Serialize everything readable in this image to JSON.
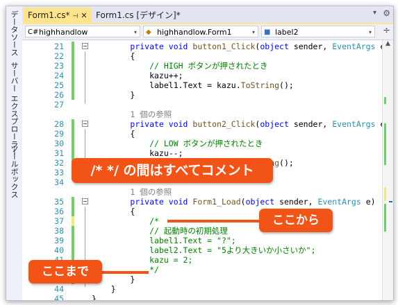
{
  "sidebar": {
    "items": [
      "データソース",
      "サーバー エクスプローラー",
      "ツールボックス"
    ]
  },
  "tabs": [
    {
      "label": "Form1.cs*",
      "pin": "⊣",
      "close": "✕"
    },
    {
      "label": "Form1.cs [デザイン]*"
    }
  ],
  "tab_menu_icon": "▾",
  "tab_settings_icon": "⚙",
  "navbar": {
    "project": "highhandlow",
    "class": "highhandlow.Form1",
    "member": "label2",
    "dropdown_icon": "▾",
    "split_icon": "÷"
  },
  "scroll": {
    "up_arrow": "▲"
  },
  "code_lines": [
    {
      "n": "21",
      "bar": "#6fcf6b",
      "fold": "⊟",
      "parts": [
        [
          "",
          "        "
        ],
        [
          "kw",
          "private void "
        ],
        [
          "mt",
          "button1_Click"
        ],
        [
          "",
          "("
        ],
        [
          "kw",
          "object"
        ],
        [
          "",
          " sender, "
        ],
        [
          "ty",
          "EventArgs"
        ],
        [
          "",
          " e)"
        ]
      ]
    },
    {
      "n": "22",
      "bar": "#6fcf6b",
      "parts": [
        [
          "",
          "        {"
        ]
      ]
    },
    {
      "n": "23",
      "bar": "#6fcf6b",
      "parts": [
        [
          "",
          "            "
        ],
        [
          "cm",
          "// HIGH ボタンが押されたとき"
        ]
      ]
    },
    {
      "n": "24",
      "bar": "#6fcf6b",
      "parts": [
        [
          "",
          "            kazu++;"
        ]
      ]
    },
    {
      "n": "25",
      "bar": "#6fcf6b",
      "parts": [
        [
          "",
          "            label1.Text = kazu."
        ],
        [
          "mt",
          "ToString"
        ],
        [
          "",
          "();"
        ]
      ]
    },
    {
      "n": "26",
      "bar": "#6fcf6b",
      "parts": [
        [
          "",
          "        }"
        ]
      ]
    },
    {
      "n": "27",
      "bar": "",
      "parts": [
        [
          "",
          ""
        ]
      ]
    },
    {
      "n": "",
      "bar": "",
      "parts": [
        [
          "ref",
          "        1 個の参照"
        ]
      ]
    },
    {
      "n": "28",
      "bar": "#6fcf6b",
      "fold": "⊟",
      "parts": [
        [
          "",
          "        "
        ],
        [
          "kw",
          "private void "
        ],
        [
          "mt",
          "button2_Click"
        ],
        [
          "",
          "("
        ],
        [
          "kw",
          "object"
        ],
        [
          "",
          " sender, "
        ],
        [
          "ty",
          "EventArgs"
        ],
        [
          "",
          " e)"
        ]
      ]
    },
    {
      "n": "29",
      "bar": "#6fcf6b",
      "parts": [
        [
          "",
          "        {"
        ]
      ]
    },
    {
      "n": "30",
      "bar": "#6fcf6b",
      "parts": [
        [
          "",
          "            "
        ],
        [
          "cm",
          "// LOW ボタンが押されたとき"
        ]
      ]
    },
    {
      "n": "31",
      "bar": "#6fcf6b",
      "parts": [
        [
          "",
          "            kazu--;"
        ]
      ]
    },
    {
      "n": "32",
      "bar": "#6fcf6b",
      "parts": [
        [
          "",
          "            label1.Text = kazu."
        ],
        [
          "mt",
          "ToString"
        ],
        [
          "",
          "();"
        ]
      ]
    },
    {
      "n": "33",
      "bar": "#6fcf6b",
      "parts": [
        [
          "",
          "        }"
        ]
      ]
    },
    {
      "n": "34",
      "bar": "",
      "parts": [
        [
          "",
          ""
        ]
      ]
    },
    {
      "n": "",
      "bar": "",
      "parts": [
        [
          "ref",
          "        1 個の参照"
        ]
      ]
    },
    {
      "n": "35",
      "bar": "#6fcf6b",
      "fold": "⊟",
      "parts": [
        [
          "",
          "        "
        ],
        [
          "kw",
          "private void "
        ],
        [
          "mt",
          "Form1_Load"
        ],
        [
          "",
          "("
        ],
        [
          "kw",
          "object"
        ],
        [
          "",
          " sender, "
        ],
        [
          "ty",
          "EventArgs"
        ],
        [
          "",
          " e)"
        ]
      ]
    },
    {
      "n": "36",
      "bar": "#6fcf6b",
      "parts": [
        [
          "",
          "        {"
        ]
      ]
    },
    {
      "n": "37",
      "bar": "#f2e77a",
      "parts": [
        [
          "",
          "            "
        ],
        [
          "cm",
          "/*"
        ]
      ]
    },
    {
      "n": "38",
      "bar": "#6fcf6b",
      "parts": [
        [
          "",
          "            "
        ],
        [
          "cm",
          "// 起動時の初期処理"
        ]
      ]
    },
    {
      "n": "39",
      "bar": "#6fcf6b",
      "parts": [
        [
          "",
          "            "
        ],
        [
          "cm",
          "label1.Text = \"?\";"
        ]
      ]
    },
    {
      "n": "40",
      "bar": "#6fcf6b",
      "parts": [
        [
          "",
          "            "
        ],
        [
          "cm",
          "label2.Text = \"5より大きいか小さいか\";"
        ]
      ]
    },
    {
      "n": "41",
      "bar": "#6fcf6b",
      "parts": [
        [
          "",
          "            "
        ],
        [
          "cm",
          "kazu = 2;"
        ]
      ]
    },
    {
      "n": "42",
      "bar": "#f2e77a",
      "parts": [
        [
          "",
          "            "
        ],
        [
          "cm",
          "*/"
        ]
      ]
    },
    {
      "n": "43",
      "bar": "#6fcf6b",
      "parts": [
        [
          "",
          "        }"
        ]
      ]
    },
    {
      "n": "44",
      "bar": "",
      "parts": [
        [
          "",
          "    }"
        ]
      ]
    },
    {
      "n": "45",
      "bar": "",
      "parts": [
        [
          "",
          "}"
        ]
      ]
    }
  ],
  "callouts": {
    "all_comment": "/* */ の間はすべてコメント",
    "start": "ここから",
    "end": "ここまで"
  },
  "colors": {
    "callout": "#f25418",
    "active_tab": "#ffe48c",
    "change_saved": "#6fcf6b",
    "change_unsaved": "#f2e77a",
    "keyword": "#0000ff",
    "comment": "#008000",
    "line_number": "#2b91af"
  }
}
